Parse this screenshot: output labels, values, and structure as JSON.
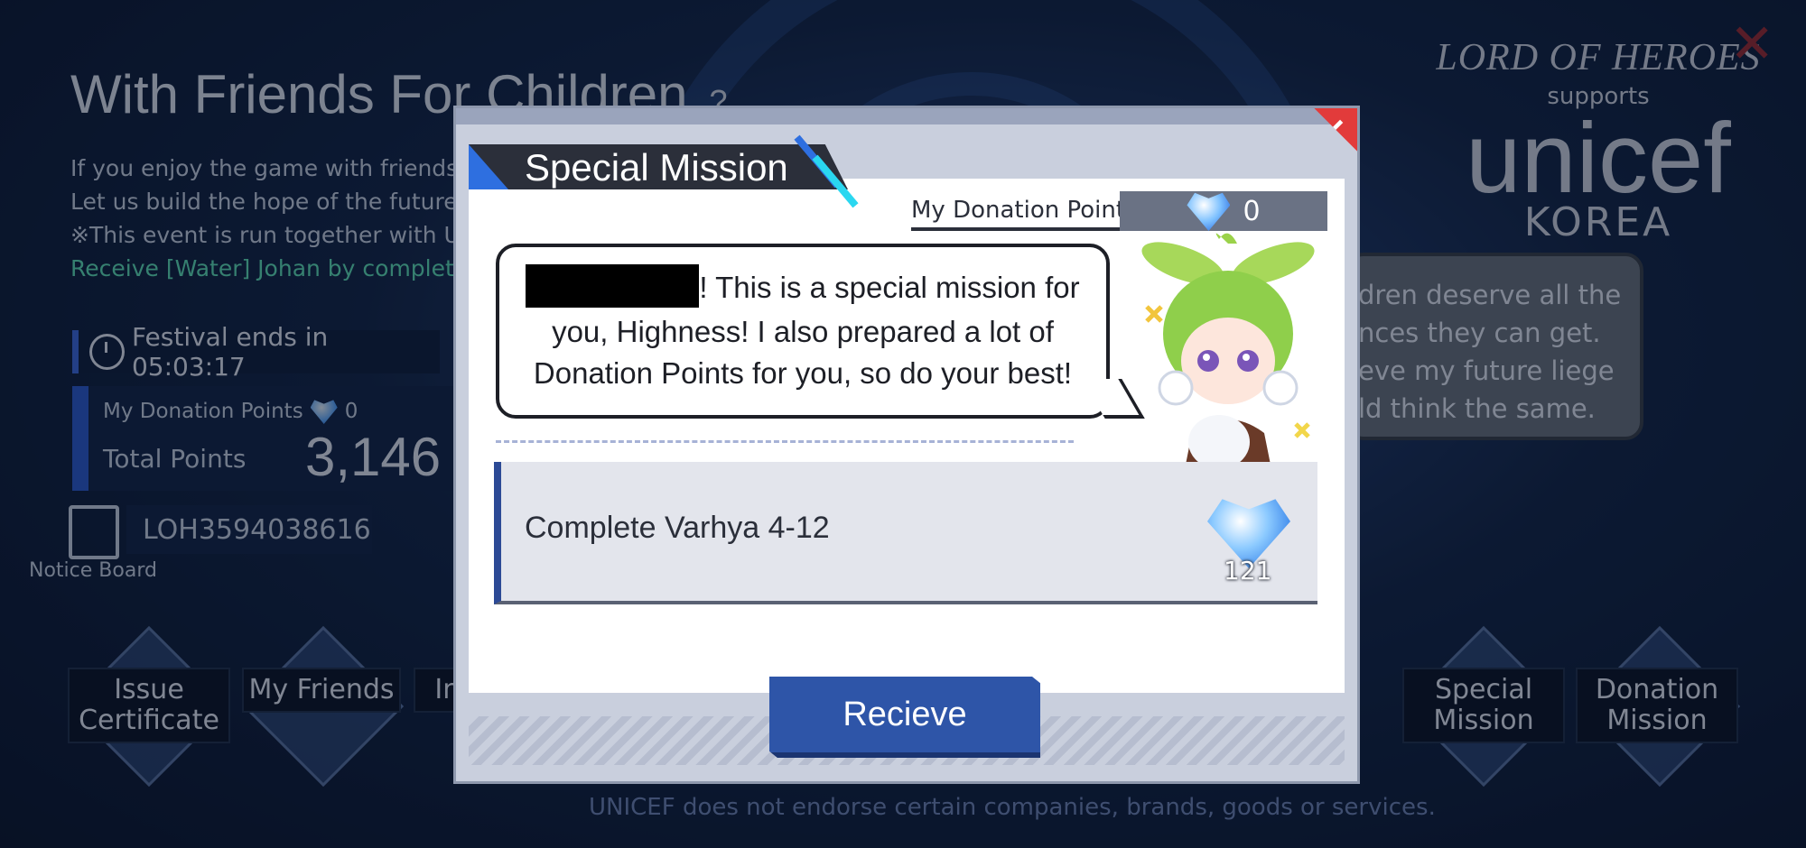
{
  "background": {
    "title": "With Friends For Children",
    "description_lines": [
      "If you enjoy the game with friends, y",
      "Let us build the hope of the future t",
      "※This event is run together with UN"
    ],
    "description_green": "Receive [Water] Johan by completi",
    "festival_text": "Festival ends in 05:03:17",
    "my_donation_points_label": "My Donation Points",
    "my_donation_points_value": "0",
    "total_points_label": "Total Points",
    "total_points_value": "3,146",
    "notice_board_label": "Notice Board",
    "code_value": "LOH3594038616",
    "bottom_buttons": [
      {
        "label": "Issue Certificate"
      },
      {
        "label": "My Friends"
      },
      {
        "label": "Inp Code"
      },
      {
        "label": "Special Mission"
      },
      {
        "label": "Donation Mission"
      }
    ],
    "brand_logo": "LORD OF HEROES",
    "brand_supports": "supports",
    "brand_unicef": "unicef",
    "brand_korea": "KOREA",
    "right_bubble_lines": [
      "dren deserve all the",
      "nces they can get.",
      "eve my future liege",
      "ld think the same."
    ],
    "footer": "UNICEF does not endorse certain companies, brands, goods or services."
  },
  "modal": {
    "title": "Special Mission",
    "my_donation_points_label": "My Donation Points",
    "my_donation_points_value": "0",
    "speech_line1_suffix": "! This is a special mission for",
    "speech_line2": "you, Highness! I also prepared a lot of",
    "speech_line3": "Donation Points for you, so do your best!",
    "mission_text": "Complete Varhya 4-12",
    "reward_count": "121",
    "receive_label": "Recieve"
  },
  "colors": {
    "accent_blue": "#2e55a8",
    "close_red": "#e23b3b",
    "gem_blue": "#2e6fe0"
  }
}
